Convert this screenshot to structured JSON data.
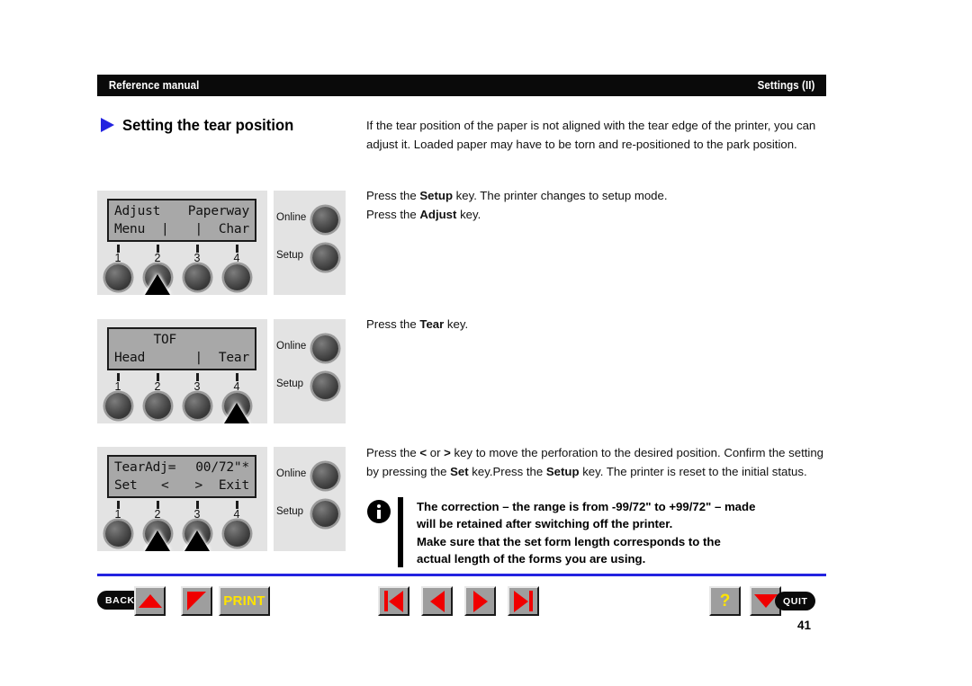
{
  "header": {
    "left": "Reference manual",
    "right": "Settings (II)"
  },
  "section": {
    "title": "Setting the tear position",
    "arrow_color": "#2323e0"
  },
  "paragraphs": {
    "intro_html": "If the tear position of the paper is not aligned with the tear edge of the printer, you can adjust it. Loaded paper may have to be torn and re-positioned to the park position.",
    "setup_html": "Press the <b>Setup</b> key. The printer changes to setup mode.<br>Press the <b>Adjust</b> key.",
    "tear_html": "Press the <b>Tear</b> key.",
    "move_html": "Press the <b>&lt;</b> or <b>&gt;</b> key to move the perforation to the desired position. Confirm the setting by pressing the <b>Set</b> key.Press the <b>Setup</b> key. The printer is reset to the initial status."
  },
  "note": {
    "icon": "info-icon",
    "line1": "The correction – the range is from -99/72\" to +99/72\" – made",
    "line2": "will be retained after switching off the printer.",
    "line3": "Make sure that the set form length corresponds to the",
    "line4": "actual length of the forms you are using."
  },
  "panels": [
    {
      "id": "panel-adjust",
      "lcd": {
        "row1": [
          "Adjust",
          "",
          "",
          "Paperway"
        ],
        "row2": [
          "Menu",
          "|",
          "|",
          "Char"
        ]
      },
      "keys": [
        "1",
        "2",
        "3",
        "4"
      ],
      "pressed_key_index": 1,
      "side_buttons": [
        "Online",
        "Setup"
      ]
    },
    {
      "id": "panel-tof",
      "lcd": {
        "row1": [
          "",
          "TOF",
          "",
          ""
        ],
        "row2": [
          "Head",
          "",
          "|",
          "Tear"
        ]
      },
      "keys": [
        "1",
        "2",
        "3",
        "4"
      ],
      "pressed_key_index": 3,
      "side_buttons": [
        "Online",
        "Setup"
      ]
    },
    {
      "id": "panel-tearadj",
      "lcd": {
        "row1": [
          "TearAdj=",
          "",
          "00/72\"*",
          ""
        ],
        "row2": [
          "Set",
          "<",
          ">",
          "Exit"
        ]
      },
      "keys": [
        "1",
        "2",
        "3",
        "4"
      ],
      "pressed_key_index": 1,
      "pressed_key_index2": 2,
      "side_buttons": [
        "Online",
        "Setup"
      ]
    }
  ],
  "nav": {
    "back_label": "BACK",
    "print_label": "PRINT",
    "quit_label": "QUIT",
    "help_label": "?",
    "up_icon": "triangle-up-icon",
    "corner_icon": "triangle-corner-icon",
    "first_icon": "first-page-icon",
    "prev_icon": "previous-page-icon",
    "next_icon": "next-page-icon",
    "last_icon": "last-page-icon",
    "down_icon": "triangle-down-icon",
    "rule_color": "#2323e0"
  },
  "page_number": "41"
}
